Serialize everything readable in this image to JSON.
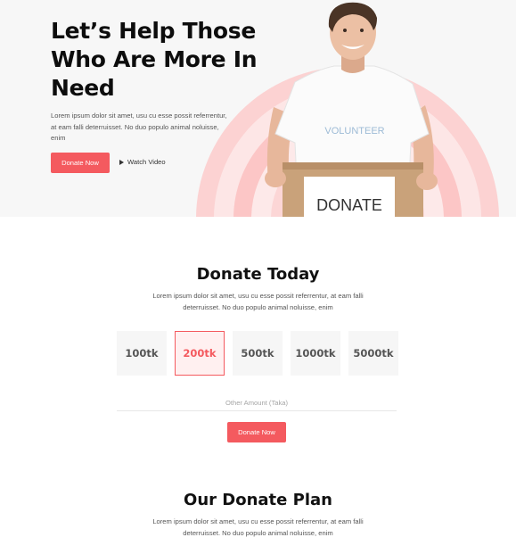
{
  "hero": {
    "title": "Let’s Help Those Who Are More In Need",
    "text": "Lorem ipsum dolor sit amet, usu cu esse possit referrentur, at eam falli deterruisset. No duo populo animal noluisse, enim",
    "donate_label": "Donate Now",
    "watch_label": "Watch Video",
    "shirt_text": "VOLUNTEER",
    "box_text": "DONATE"
  },
  "donate_today": {
    "title": "Donate Today",
    "text": "Lorem ipsum dolor sit amet, usu cu esse possit referrentur, at eam falli deterruisset. No duo populo animal noluisse, enim",
    "amounts": [
      "100tk",
      "200tk",
      "500tk",
      "1000tk",
      "5000tk"
    ],
    "selected": "200tk",
    "other_placeholder": "Other Amount (Taka)",
    "donate_label": "Donate Now"
  },
  "donate_plan": {
    "title": "Our Donate Plan",
    "text": "Lorem ipsum dolor sit amet, usu cu esse possit referrentur, at eam falli deterruisset. No duo populo animal noluisse, enim"
  },
  "colors": {
    "accent": "#f45a5f",
    "hero_bg": "#f7f7f7",
    "ring_outer": "#fde3e3",
    "ring_inner": "#fbc3c3"
  }
}
